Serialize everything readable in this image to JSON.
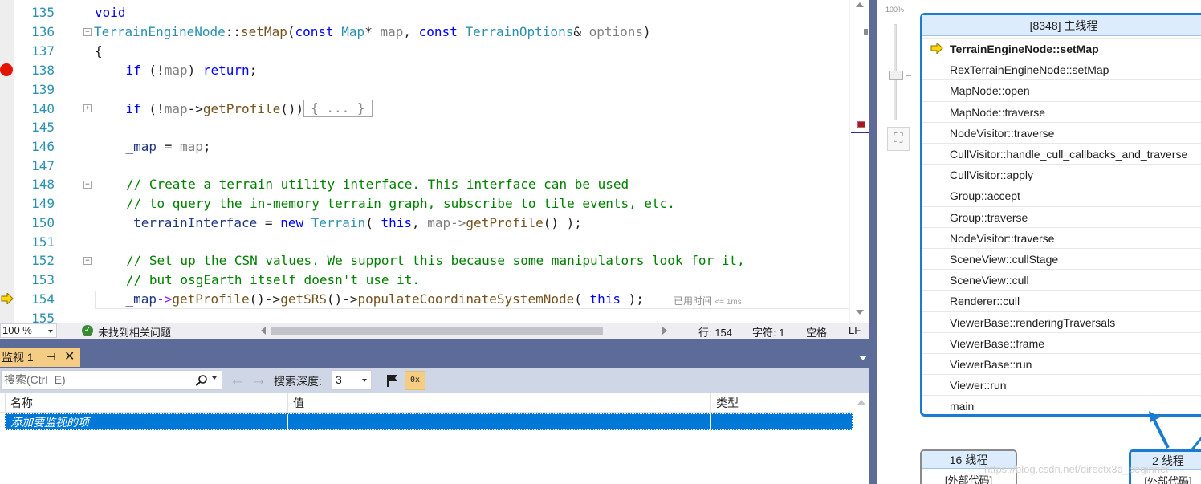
{
  "editor": {
    "lines": [
      {
        "n": "135"
      },
      {
        "n": "136"
      },
      {
        "n": "137"
      },
      {
        "n": "138"
      },
      {
        "n": "139"
      },
      {
        "n": "140"
      },
      {
        "n": "145"
      },
      {
        "n": "146"
      },
      {
        "n": "147"
      },
      {
        "n": "148"
      },
      {
        "n": "149"
      },
      {
        "n": "150"
      },
      {
        "n": "151"
      },
      {
        "n": "152"
      },
      {
        "n": "153"
      },
      {
        "n": "154"
      },
      {
        "n": "155"
      }
    ],
    "code": {
      "l135_kw": "void",
      "l136_type": "TerrainEngineNode",
      "l136_sep": "::",
      "l136_fn": "setMap",
      "l136_open": "(",
      "l136_const1": "const",
      "l136_map_type": "Map",
      "l136_star": "*",
      "l136_map": "map",
      "l136_comma": ",",
      "l136_const2": "const",
      "l136_opt_type": "TerrainOptions",
      "l136_amp": "&",
      "l136_opt": "options",
      "l136_close": ")",
      "l137": "{",
      "l138_if": "if",
      "l138_a": " (!",
      "l138_map": "map",
      "l138_b": ") ",
      "l138_return": "return",
      "l138_c": ";",
      "l140_if": "if",
      "l140_a": " (!",
      "l140_map": "map",
      "l140_arrow": "->",
      "l140_fn": "getProfile",
      "l140_b": "())",
      "l140_collapsed": "{ ... }",
      "l146_field": "_map",
      "l146_eq": " = ",
      "l146_map": "map",
      "l146_end": ";",
      "l148": "// Create a terrain utility interface. This interface can be used",
      "l149": "// to query the in-memory terrain graph, subscribe to tile events, etc.",
      "l150_field": "_terrainInterface",
      "l150_eq": " = ",
      "l150_new": "new",
      "l150_type": "Terrain",
      "l150_open": "( ",
      "l150_this": "this",
      "l150_comma": ", ",
      "l150_map": "map",
      "l150_arrow": "->",
      "l150_fn": "getProfile",
      "l150_end": "() );",
      "l152": "// Set up the CSN values. We support this because some manipulators look for it,",
      "l153": "// but osgEarth itself doesn't use it.",
      "l154_field": "_map",
      "l154_a1": "->",
      "l154_f1": "getProfile",
      "l154_p1": "()",
      "l154_a2": "->",
      "l154_f2": "getSRS",
      "l154_p2": "()",
      "l154_a3": "->",
      "l154_f3": "populateCoordinateSystemNode",
      "l154_open": "( ",
      "l154_this": "this",
      "l154_end": " );"
    },
    "elapsed_label": "已用时间",
    "elapsed_value": "<= 1ms"
  },
  "status": {
    "zoom": "100 %",
    "issues": "未找到相关问题",
    "line": "行: 154",
    "char": "字符: 1",
    "whitespace": "空格",
    "eol": "LF"
  },
  "watch": {
    "tab_title": "监视 1",
    "pin_glyph": "⊣",
    "close_glyph": "✕",
    "search_placeholder": "搜索(Ctrl+E)",
    "depth_label": "搜索深度:",
    "depth_value": "3",
    "hex_glyph": "0x",
    "columns": [
      "名称",
      "值",
      "类型"
    ],
    "add_item": "添加要监视的项"
  },
  "stacks": {
    "zoom_pct": "100%",
    "main_thread_title": "[8348] 主线程",
    "frames": [
      "TerrainEngineNode::setMap",
      "RexTerrainEngineNode::setMap",
      "MapNode::open",
      "MapNode::traverse",
      "NodeVisitor::traverse",
      "CullVisitor::handle_cull_callbacks_and_traverse",
      "CullVisitor::apply",
      "Group::accept",
      "Group::traverse",
      "NodeVisitor::traverse",
      "SceneView::cullStage",
      "SceneView::cull",
      "Renderer::cull",
      "ViewerBase::renderingTraversals",
      "ViewerBase::frame",
      "ViewerBase::run",
      "Viewer::run",
      "main"
    ],
    "thread16_title": "16 线程",
    "thread16_body": "[外部代码]",
    "thread2_title": "2 线程",
    "thread2_body": "[外部代码]",
    "watermark": "https://blog.csdn.net/directx3d_beginner"
  },
  "colors": {
    "accent": "#1a7cd1",
    "tool_window_frame": "#5d6b99",
    "active_tab": "#f5cc84",
    "selection": "#0078d7",
    "breakpoint": "#e51400"
  },
  "icons": {
    "breakpoint": "breakpoint-icon",
    "current_statement": "current-statement-arrow-icon",
    "ok": "check-circle-icon",
    "search": "search-icon",
    "back": "arrow-left-icon",
    "forward": "arrow-right-icon",
    "filter": "filter-icon",
    "hex": "hex-display-icon",
    "pin": "pin-icon",
    "close": "close-icon"
  }
}
